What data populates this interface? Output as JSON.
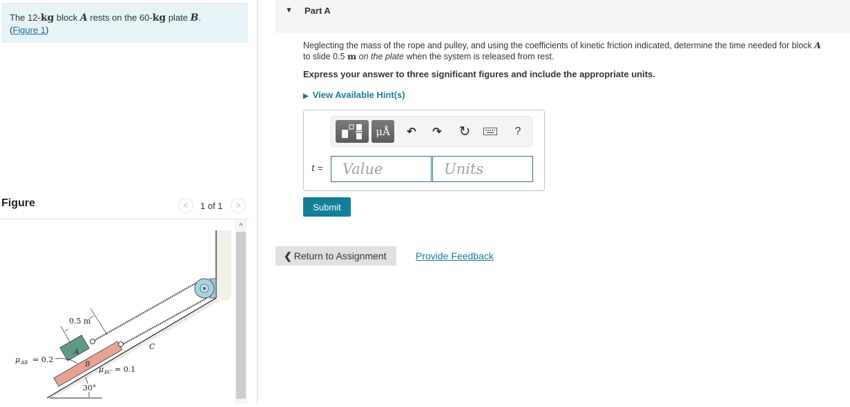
{
  "intro": {
    "parts": [
      "The 12-",
      "kg",
      " block ",
      "A",
      " rests on the 60-",
      "kg",
      " plate ",
      "B",
      "."
    ],
    "figure_link_open": "(",
    "figure_link": "Figure 1",
    "figure_link_close": ")"
  },
  "figure": {
    "title": "Figure",
    "prev_icon": "chevron-left-icon",
    "next_icon": "chevron-right-icon",
    "prev_glyph": "<",
    "next_glyph": ">",
    "counter": "1 of 1",
    "scroll_up_glyph": "^",
    "diagram": {
      "dimension_label": "0.5 m",
      "mu_ab_label": "μ",
      "mu_ab_sub": "AB",
      "mu_ab_value": "= 0.2",
      "mu_bc_label": "μ",
      "mu_bc_sub": "BC",
      "mu_bc_value": "= 0.1",
      "block_a_label": "A",
      "plate_b_label": "B",
      "surface_c_label": "C",
      "angle_label": "30°",
      "colors": {
        "block_a": "#5f9a89",
        "plate_b": "#e8a394",
        "pulley": "#a9d3df"
      }
    }
  },
  "part": {
    "caret": "▼",
    "title": "Part A"
  },
  "question": {
    "line1_a": "Neglecting the mass of the rope and pulley, and using the coefficients of kinetic friction indicated, determine the time needed for block ",
    "line1_var": "A",
    "line2_a": "to slide 0.5 ",
    "line2_unit": "m",
    "line2_italic": " on the plate",
    "line2_b": " when the system is released from rest."
  },
  "instruction": "Express your answer to three significant figures and include the appropriate units.",
  "hints": {
    "arrow": "▶",
    "label": "View Available Hint(s)"
  },
  "answer": {
    "toolbar": {
      "templates_icon": "templates-icon",
      "symbols_label": "μÅ",
      "undo_glyph": "↶",
      "redo_glyph": "↷",
      "reset_glyph": "↻",
      "keyboard_icon": "keyboard-icon",
      "help_label": "?"
    },
    "variable": "t",
    "equals": "=",
    "value_placeholder": "Value",
    "units_placeholder": "Units"
  },
  "submit_label": "Submit",
  "return_label": "Return to Assignment",
  "return_chevron": "❮",
  "feedback_label": "Provide Feedback",
  "colors": {
    "accent": "#127f99",
    "link": "#1b7a96",
    "intro_bg": "#e6f4f7"
  }
}
